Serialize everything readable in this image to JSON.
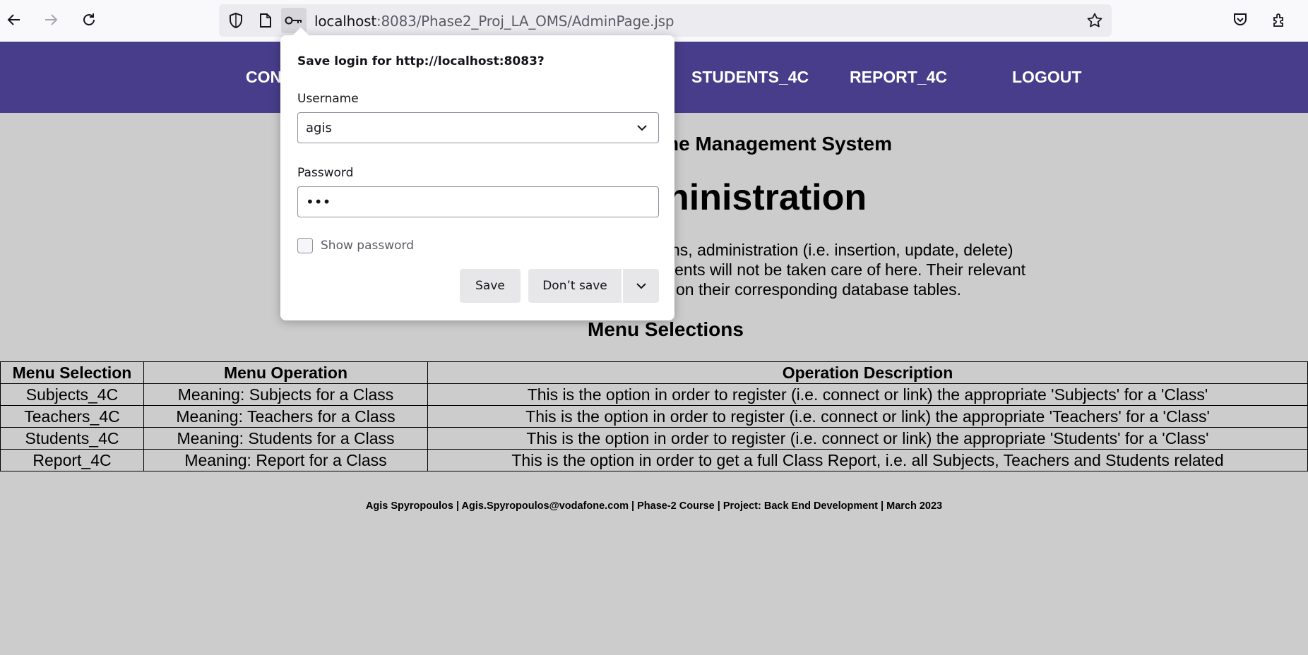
{
  "browser": {
    "url_host": "localhost",
    "url_rest": ":8083/Phase2_Proj_LA_OMS/AdminPage.jsp",
    "icons": [
      "back-arrow-icon",
      "forward-arrow-icon",
      "reload-icon",
      "shield-icon",
      "page-icon",
      "key-icon",
      "star-icon",
      "pocket-icon",
      "extensions-icon"
    ]
  },
  "nav": {
    "items": [
      "CON",
      "STUDENTS_4C",
      "REPORT_4C",
      "LOGOUT"
    ]
  },
  "page": {
    "subtitle": "ne Management System",
    "heading": "ninistration",
    "para_lines": [
      "ns, administration (i.e. insertion, update, delete)",
      "lents will not be taken care of here. Their relevant",
      "on their corresponding database tables."
    ],
    "menu_title": "Menu Selections",
    "table": {
      "headers": [
        "Menu Selection",
        "Menu Operation",
        "Operation Description"
      ],
      "rows": [
        [
          "Subjects_4C",
          "Meaning: Subjects for a Class",
          "This is the option in order to register (i.e. connect or link) the appropriate 'Subjects' for a 'Class'"
        ],
        [
          "Teachers_4C",
          "Meaning: Teachers for a Class",
          "This is the option in order to register (i.e. connect or link) the appropriate 'Teachers' for a 'Class'"
        ],
        [
          "Students_4C",
          "Meaning: Students for a Class",
          "This is the option in order to register (i.e. connect or link) the appropriate 'Students' for a 'Class'"
        ],
        [
          "Report_4C",
          "Meaning: Report for a Class",
          "This is the option in order to get a full Class Report, i.e. all Subjects, Teachers and Students related"
        ]
      ]
    },
    "footer": "Agis Spyropoulos | Agis.Spyropoulos@vodafone.com | Phase-2 Course | Project: Back End Development | March 2023"
  },
  "popup": {
    "title": "Save login for http://localhost:8083?",
    "username_label": "Username",
    "username_value": "agis",
    "password_label": "Password",
    "password_value": "•••",
    "show_password_label": "Show password",
    "save_button": "Save",
    "dont_save_button": "Don’t save"
  },
  "colors": {
    "nav_bg": "#483d8b",
    "page_bg": "#cccccc"
  }
}
